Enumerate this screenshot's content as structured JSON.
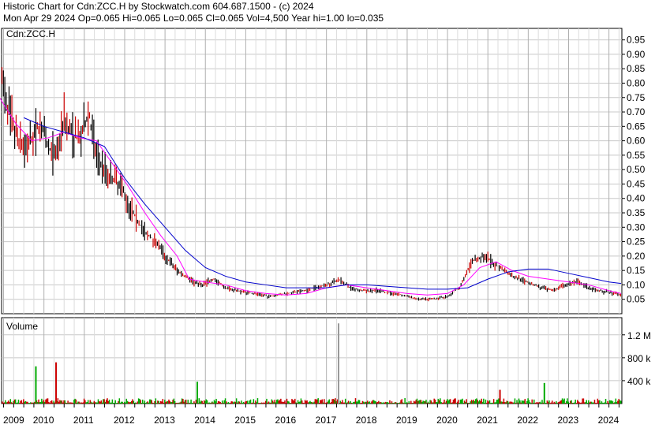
{
  "header": {
    "line1": "Historic Chart for Cdn:ZCC.H by Stockwatch.com 604.687.1500 - (c) 2024",
    "line2": "Mon Apr 29 2024   Op=0.065  Hi=0.065  Lo=0.065  Cl=0.065  Vol=4,500  Year hi=1.00  lo=0.035"
  },
  "chart_data": [
    {
      "type": "line",
      "title": "Cdn:ZCC.H",
      "ylim": [
        0.0,
        0.99
      ],
      "yticks": [
        0.05,
        0.1,
        0.15,
        0.2,
        0.25,
        0.3,
        0.35,
        0.4,
        0.45,
        0.5,
        0.55,
        0.6,
        0.65,
        0.7,
        0.75,
        0.8,
        0.85,
        0.9,
        0.95
      ],
      "ytick_labels": [
        "0.05",
        "0.10",
        "0.15",
        "0.20",
        "0.25",
        "0.30",
        "0.35",
        "0.40",
        "0.45",
        "0.50",
        "0.55",
        "0.60",
        "0.65",
        "0.70",
        "0.75",
        "0.80",
        "0.85",
        "0.90",
        "0.95"
      ],
      "x_labels": [
        "2009",
        "2010",
        "2011",
        "2012",
        "2013",
        "2014",
        "2015",
        "2016",
        "2017",
        "2018",
        "2019",
        "2020",
        "2021",
        "2022",
        "2023",
        "2024"
      ],
      "grid": true,
      "colors": {
        "price_up": "#000000",
        "price_down": "#cc0000",
        "ma_short": "#ff00ff",
        "ma_long": "#0000cc"
      },
      "series": [
        {
          "role": "price",
          "x": [
            2008.9,
            2009.1,
            2009.3,
            2009.5,
            2009.7,
            2009.9,
            2010.1,
            2010.3,
            2010.5,
            2010.7,
            2010.9,
            2011.1,
            2011.3,
            2011.6,
            2011.9,
            2012.1,
            2012.3,
            2012.5,
            2012.8,
            2013.0,
            2013.3,
            2013.6,
            2013.9,
            2014.2,
            2014.5,
            2014.8,
            2015.2,
            2015.6,
            2016.0,
            2016.5,
            2017.0,
            2017.3,
            2017.6,
            2017.9,
            2018.3,
            2018.7,
            2019.0,
            2019.3,
            2019.6,
            2020.0,
            2020.3,
            2020.6,
            2020.9,
            2021.2,
            2021.6,
            2022.0,
            2022.3,
            2022.6,
            2022.9,
            2023.2,
            2023.5,
            2023.8,
            2024.1,
            2024.3
          ],
          "values": [
            0.85,
            0.72,
            0.62,
            0.58,
            0.6,
            0.66,
            0.58,
            0.55,
            0.68,
            0.62,
            0.6,
            0.7,
            0.55,
            0.48,
            0.45,
            0.38,
            0.33,
            0.28,
            0.25,
            0.2,
            0.15,
            0.12,
            0.1,
            0.12,
            0.09,
            0.08,
            0.07,
            0.06,
            0.07,
            0.08,
            0.1,
            0.12,
            0.09,
            0.08,
            0.08,
            0.07,
            0.06,
            0.05,
            0.05,
            0.06,
            0.09,
            0.18,
            0.2,
            0.17,
            0.13,
            0.11,
            0.09,
            0.08,
            0.1,
            0.11,
            0.09,
            0.08,
            0.07,
            0.065
          ]
        },
        {
          "role": "ma_short",
          "x": [
            2008.9,
            2009.3,
            2009.7,
            2010.1,
            2010.5,
            2010.9,
            2011.3,
            2011.7,
            2012.1,
            2012.5,
            2012.9,
            2013.3,
            2013.6,
            2014.0,
            2014.5,
            2015.0,
            2015.5,
            2016.0,
            2016.5,
            2017.0,
            2017.5,
            2018.0,
            2018.5,
            2019.0,
            2019.5,
            2020.0,
            2020.4,
            2020.8,
            2021.2,
            2021.6,
            2022.0,
            2022.5,
            2023.0,
            2023.5,
            2024.0,
            2024.3
          ],
          "values": [
            0.75,
            0.66,
            0.6,
            0.61,
            0.63,
            0.61,
            0.6,
            0.52,
            0.44,
            0.35,
            0.27,
            0.2,
            0.12,
            0.11,
            0.1,
            0.08,
            0.07,
            0.065,
            0.07,
            0.09,
            0.1,
            0.09,
            0.08,
            0.07,
            0.065,
            0.07,
            0.1,
            0.16,
            0.18,
            0.15,
            0.13,
            0.12,
            0.11,
            0.1,
            0.08,
            0.07
          ]
        },
        {
          "role": "ma_long",
          "x": [
            2009.5,
            2010.0,
            2010.5,
            2011.0,
            2011.5,
            2012.0,
            2012.5,
            2013.0,
            2013.5,
            2014.0,
            2014.5,
            2015.0,
            2015.5,
            2016.0,
            2016.5,
            2017.0,
            2017.5,
            2018.0,
            2018.5,
            2019.0,
            2019.5,
            2020.0,
            2020.5,
            2021.0,
            2021.5,
            2022.0,
            2022.5,
            2023.0,
            2023.5,
            2024.0,
            2024.3
          ],
          "values": [
            0.68,
            0.65,
            0.63,
            0.61,
            0.58,
            0.47,
            0.38,
            0.3,
            0.22,
            0.16,
            0.13,
            0.11,
            0.1,
            0.09,
            0.09,
            0.09,
            0.1,
            0.1,
            0.095,
            0.09,
            0.085,
            0.085,
            0.09,
            0.12,
            0.145,
            0.155,
            0.155,
            0.14,
            0.125,
            0.11,
            0.105
          ]
        }
      ]
    },
    {
      "type": "bar",
      "title": "Volume",
      "ylim": [
        0,
        1500000
      ],
      "yticks": [
        400000,
        800000,
        1200000
      ],
      "ytick_labels": [
        "400 k",
        "800 k",
        "1.2 M"
      ],
      "colors": {
        "up": "#00aa00",
        "down": "#cc0000",
        "flat": "#999999"
      },
      "peaks": [
        {
          "x": 2009.8,
          "value": 650000,
          "dir": "up"
        },
        {
          "x": 2010.3,
          "value": 720000,
          "dir": "down"
        },
        {
          "x": 2013.8,
          "value": 380000,
          "dir": "up"
        },
        {
          "x": 2017.3,
          "value": 1400000,
          "dir": "flat"
        },
        {
          "x": 2021.3,
          "value": 240000,
          "dir": "down"
        },
        {
          "x": 2022.4,
          "value": 360000,
          "dir": "up"
        }
      ],
      "baseline_level": 60000
    }
  ]
}
